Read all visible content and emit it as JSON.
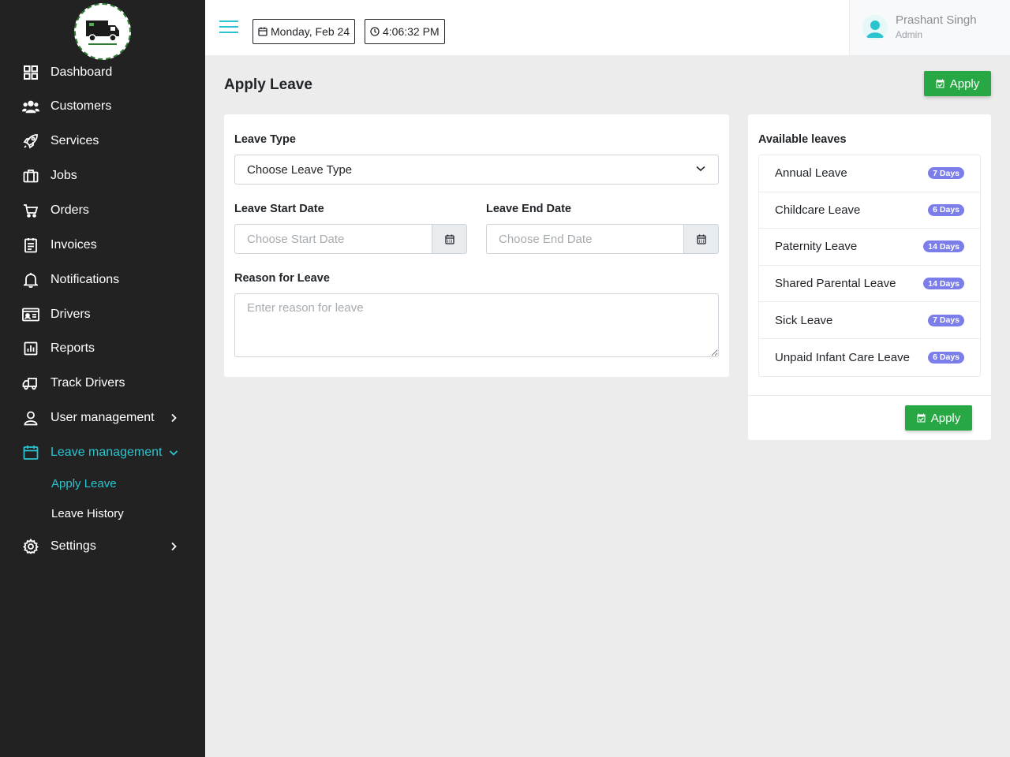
{
  "sidebar": {
    "items": [
      {
        "label": "Dashboard",
        "icon": "dashboard-grid-icon"
      },
      {
        "label": "Customers",
        "icon": "users-icon"
      },
      {
        "label": "Services",
        "icon": "rocket-icon"
      },
      {
        "label": "Jobs",
        "icon": "briefcase-icon"
      },
      {
        "label": "Orders",
        "icon": "cart-icon"
      },
      {
        "label": "Invoices",
        "icon": "invoice-icon"
      },
      {
        "label": "Notifications",
        "icon": "bell-icon"
      },
      {
        "label": "Drivers",
        "icon": "id-card-icon"
      },
      {
        "label": "Reports",
        "icon": "bar-chart-icon"
      },
      {
        "label": "Track Drivers",
        "icon": "truck-icon"
      },
      {
        "label": "User management",
        "icon": "user-icon"
      },
      {
        "label": "Leave management",
        "icon": "calendar-icon"
      },
      {
        "label": "Settings",
        "icon": "gear-icon"
      }
    ],
    "sub_items": [
      {
        "label": "Apply Leave"
      },
      {
        "label": "Leave History"
      }
    ],
    "active_color": "#29c4cf"
  },
  "header": {
    "date": "Monday, Feb 24",
    "time": "4:06:32 PM",
    "user": {
      "name": "Prashant Singh",
      "role": "Admin"
    }
  },
  "page": {
    "title": "Apply Leave",
    "apply_label": "Apply"
  },
  "form": {
    "leave_type_label": "Leave Type",
    "leave_type_value": "Choose Leave Type",
    "start_label": "Leave Start Date",
    "start_placeholder": "Choose Start Date",
    "end_label": "Leave End Date",
    "end_placeholder": "Choose End Date",
    "reason_label": "Reason for Leave",
    "reason_placeholder": "Enter reason for leave"
  },
  "available": {
    "title": "Available leaves",
    "leaves": [
      {
        "name": "Annual Leave",
        "days": "7 Days"
      },
      {
        "name": "Childcare Leave",
        "days": "6 Days"
      },
      {
        "name": "Paternity Leave",
        "days": "14 Days"
      },
      {
        "name": "Shared Parental Leave",
        "days": "14 Days"
      },
      {
        "name": "Sick Leave",
        "days": "7 Days"
      },
      {
        "name": "Unpaid Infant Care Leave",
        "days": "6 Days"
      }
    ],
    "apply_label": "Apply"
  },
  "colors": {
    "sidebar_bg": "#222222",
    "accent": "#29c4cf",
    "success": "#28a745",
    "badge": "#7b7ee8"
  }
}
